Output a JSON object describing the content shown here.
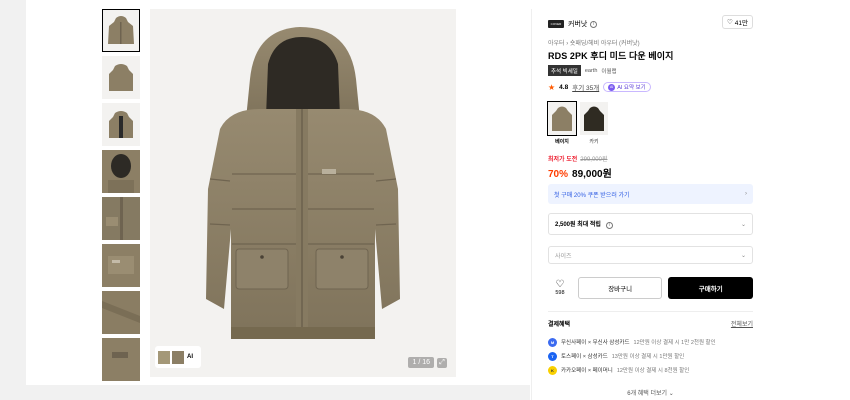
{
  "brand": {
    "name": "커버낫",
    "like_count": "41만"
  },
  "product": {
    "breadcrumb": "아우터 › 숏패딩/헤비 아우터 (커버낫)",
    "title": "RDS 2PK 후디 미드 다운 베이지",
    "tag": "추석 빅세일",
    "tag2": "earth",
    "tag3": "이월랩",
    "rating": "4.8",
    "review_link": "후기 35개",
    "ai_summary": "AI 요약 보기",
    "colors": [
      {
        "label": "베이지",
        "selected": true
      },
      {
        "label": "카키",
        "selected": false
      }
    ],
    "sale_label": "최저가 도전",
    "original_price": "299,000원",
    "discount": "70%",
    "price": "89,000원"
  },
  "coupon": {
    "text": "첫 구매 20% 쿠폰 받으러 가기"
  },
  "points": {
    "text": "2,500원 최대 적립"
  },
  "size": {
    "placeholder": "사이즈"
  },
  "actions": {
    "like_count": "598",
    "cart": "장바구니",
    "buy": "구매하기"
  },
  "benefits": {
    "title": "결제혜택",
    "all_link": "전체보기",
    "items": [
      {
        "text": "무신사페이 × 무신사 삼성카드",
        "sub": "12만원 이상 결제 시 1만 2천원 할인",
        "color": "#3c6bf0"
      },
      {
        "text": "토스페이 × 삼성카드",
        "sub": "13만원 이상 결제 시 1만원 할인",
        "color": "#1b64f2"
      },
      {
        "text": "카카오페이 × 페이머니",
        "sub": "12만원 이상 결제 시 8천원 할인",
        "color": "#f9d000"
      }
    ],
    "more": "6개 혜택 더보기 ⌄"
  },
  "gallery": {
    "counter": "1 / 16",
    "ai_label": "AI",
    "thumbnail_count": 8
  }
}
